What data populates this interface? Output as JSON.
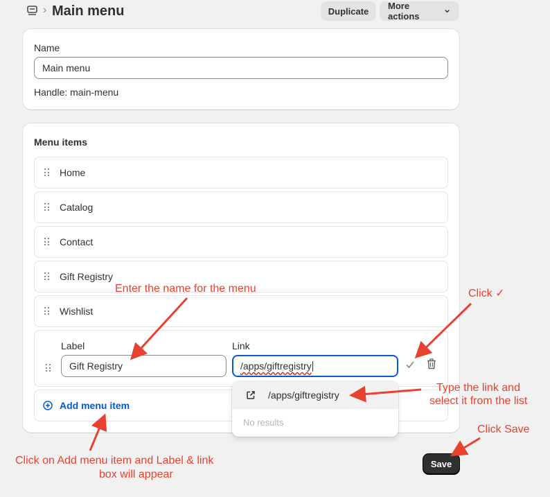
{
  "header": {
    "title": "Main menu",
    "duplicate_label": "Duplicate",
    "more_actions_label": "More actions"
  },
  "name_card": {
    "name_label": "Name",
    "name_value": "Main menu",
    "handle_text": "Handle: main-menu"
  },
  "menu_card": {
    "title": "Menu items",
    "items": [
      {
        "label": "Home"
      },
      {
        "label": "Catalog"
      },
      {
        "label": "Contact"
      },
      {
        "label": "Gift Registry"
      },
      {
        "label": "Wishlist"
      }
    ],
    "edit": {
      "label_heading": "Label",
      "label_value": "Gift Registry",
      "link_heading": "Link",
      "link_value": "/apps/giftregistry"
    },
    "add_label": "Add menu item"
  },
  "dropdown": {
    "option": "/apps/giftregistry",
    "empty_text": "No results"
  },
  "save_label": "Save",
  "annotations": {
    "enter_name": "Enter the name for the menu",
    "click_check": "Click ✓",
    "type_link_1": "Type the link and",
    "type_link_2": "select it from the list",
    "click_save": "Click Save",
    "click_add_1": "Click on Add menu item and Label  & link",
    "click_add_2": "box will appear"
  },
  "colors": {
    "accent": "#005bd3",
    "annotation": "#e8412f",
    "primary_button": "#303030"
  }
}
